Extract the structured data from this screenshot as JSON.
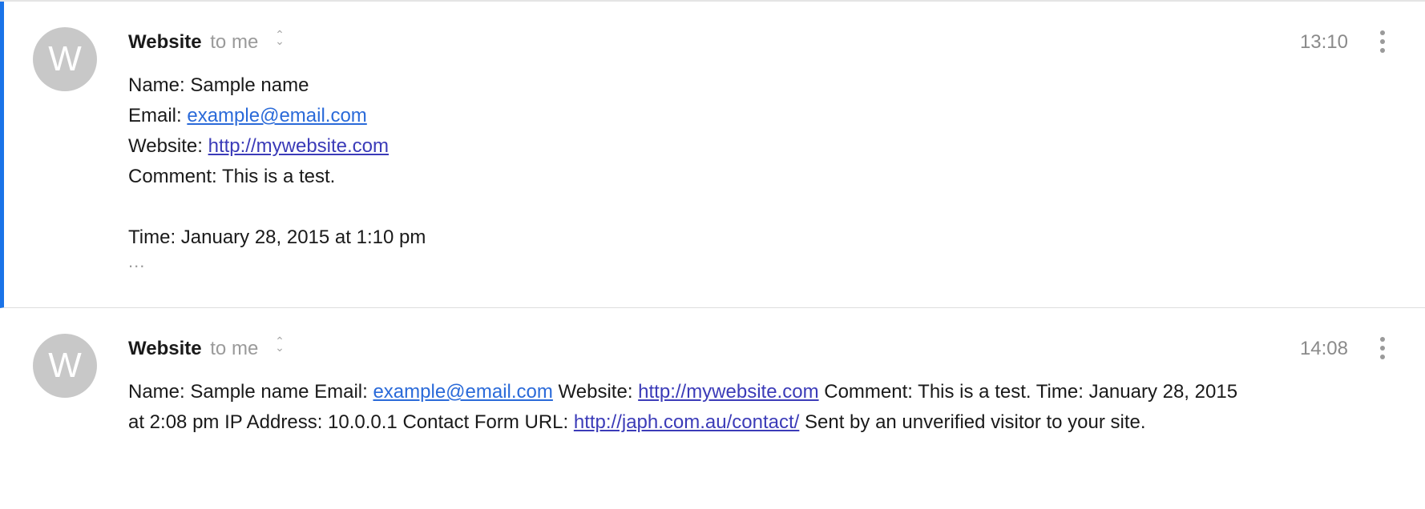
{
  "messages": [
    {
      "avatar_letter": "W",
      "sender": "Website",
      "recipient": "to me",
      "time": "13:10",
      "name_label": "Name:",
      "name_value": "Sample name",
      "email_label": "Email:",
      "email_value": "example@email.com",
      "website_label": "Website:",
      "website_value": "http://mywebsite.com",
      "comment_label": "Comment:",
      "comment_value": "This is a test.",
      "time_label": "Time:",
      "time_value": "January 28, 2015 at 1:10 pm",
      "ellipsis": "..."
    },
    {
      "avatar_letter": "W",
      "sender": "Website",
      "recipient": "to me",
      "time": "14:08",
      "text_1": "Name: Sample name Email: ",
      "email_value": "example@email.com",
      "text_2": " Website: ",
      "website_value": "http://mywebsite.com",
      "text_3": " Comment: This is a test. Time: January 28, 2015 at 2:08 pm IP Address: 10.0.0.1 Contact Form URL: ",
      "contact_url": "http://japh.com.au/contact/",
      "text_4": " Sent by an unverified visitor to your site."
    }
  ],
  "icons": {
    "expand": "chevron-up-down-icon",
    "more": "more-vertical-icon"
  },
  "colors": {
    "selected_bar": "#1a73e8",
    "link": "#2a6ad9",
    "avatar_bg": "#c8c8c8"
  }
}
